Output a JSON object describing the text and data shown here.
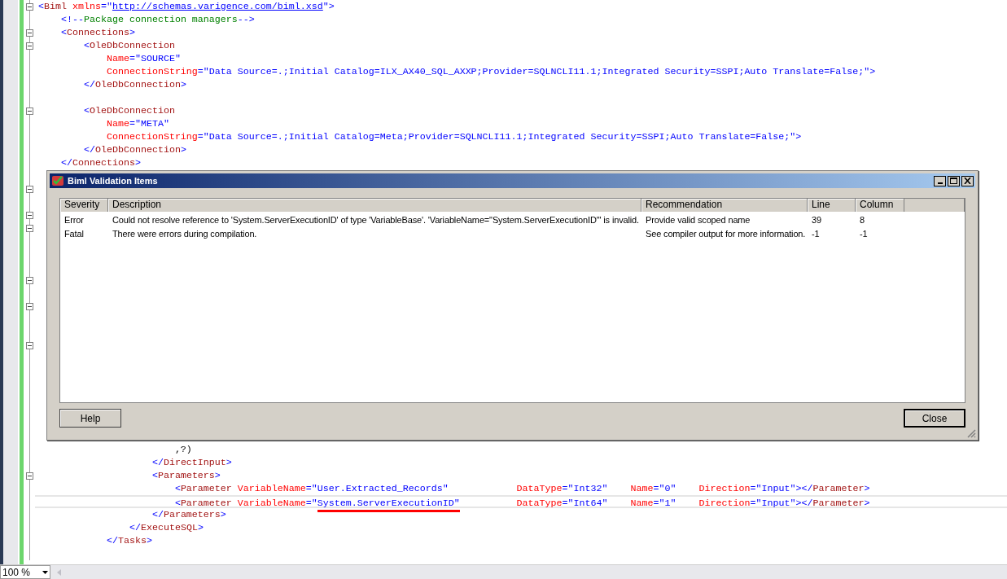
{
  "editor": {
    "lines": [
      {
        "foldable": true,
        "current": false,
        "tokens": [
          {
            "kind": "bracket",
            "text": "<"
          },
          {
            "kind": "tag",
            "text": "Biml"
          },
          {
            "kind": "attr",
            "text": " xmlns"
          },
          {
            "kind": "bracket",
            "text": "=\""
          },
          {
            "kind": "link",
            "text": "http://schemas.varigence.com/biml.xsd"
          },
          {
            "kind": "bracket",
            "text": "\">"
          }
        ]
      },
      {
        "foldable": false,
        "current": false,
        "tokens": [
          {
            "kind": "bracket",
            "text": "    <!--"
          },
          {
            "kind": "comment",
            "text": "Package connection managers"
          },
          {
            "kind": "bracket",
            "text": "-->"
          }
        ]
      },
      {
        "foldable": true,
        "current": false,
        "tokens": [
          {
            "kind": "bracket",
            "text": "    <"
          },
          {
            "kind": "tag",
            "text": "Connections"
          },
          {
            "kind": "bracket",
            "text": ">"
          }
        ]
      },
      {
        "foldable": true,
        "current": false,
        "tokens": [
          {
            "kind": "bracket",
            "text": "        <"
          },
          {
            "kind": "tag",
            "text": "OleDbConnection"
          }
        ]
      },
      {
        "foldable": false,
        "current": false,
        "tokens": [
          {
            "kind": "attr",
            "text": "            Name"
          },
          {
            "kind": "bracket",
            "text": "=\""
          },
          {
            "kind": "value",
            "text": "SOURCE"
          },
          {
            "kind": "bracket",
            "text": "\""
          }
        ]
      },
      {
        "foldable": false,
        "current": false,
        "tokens": [
          {
            "kind": "attr",
            "text": "            ConnectionString"
          },
          {
            "kind": "bracket",
            "text": "=\""
          },
          {
            "kind": "value",
            "text": "Data Source=.;Initial Catalog=ILX_AX40_SQL_AXXP;Provider=SQLNCLI11.1;Integrated Security=SSPI;Auto Translate=False;"
          },
          {
            "kind": "bracket",
            "text": "\">"
          }
        ]
      },
      {
        "foldable": false,
        "current": false,
        "tokens": [
          {
            "kind": "bracket",
            "text": "        </"
          },
          {
            "kind": "tag",
            "text": "OleDbConnection"
          },
          {
            "kind": "bracket",
            "text": ">"
          }
        ]
      },
      {
        "foldable": false,
        "current": false
      },
      {
        "foldable": true,
        "current": false,
        "tokens": [
          {
            "kind": "bracket",
            "text": "        <"
          },
          {
            "kind": "tag",
            "text": "OleDbConnection"
          }
        ]
      },
      {
        "foldable": false,
        "current": false,
        "tokens": [
          {
            "kind": "attr",
            "text": "            Name"
          },
          {
            "kind": "bracket",
            "text": "=\""
          },
          {
            "kind": "value",
            "text": "META"
          },
          {
            "kind": "bracket",
            "text": "\""
          }
        ]
      },
      {
        "foldable": false,
        "current": false,
        "tokens": [
          {
            "kind": "attr",
            "text": "            ConnectionString"
          },
          {
            "kind": "bracket",
            "text": "=\""
          },
          {
            "kind": "value",
            "text": "Data Source=.;Initial Catalog=Meta;Provider=SQLNCLI11.1;Integrated Security=SSPI;Auto Translate=False;"
          },
          {
            "kind": "bracket",
            "text": "\">"
          }
        ]
      },
      {
        "foldable": false,
        "current": false,
        "tokens": [
          {
            "kind": "bracket",
            "text": "        </"
          },
          {
            "kind": "tag",
            "text": "OleDbConnection"
          },
          {
            "kind": "bracket",
            "text": ">"
          }
        ]
      },
      {
        "foldable": false,
        "current": false,
        "tokens": [
          {
            "kind": "bracket",
            "text": "    </"
          },
          {
            "kind": "tag",
            "text": "Connections"
          },
          {
            "kind": "bracket",
            "text": ">"
          }
        ]
      },
      {
        "foldable": false,
        "current": false
      },
      {
        "foldable": true,
        "current": false
      },
      {
        "foldable": false,
        "current": false
      },
      {
        "foldable": true,
        "current": false
      },
      {
        "foldable": true,
        "current": false
      },
      {
        "foldable": false,
        "current": false
      },
      {
        "foldable": false,
        "current": false
      },
      {
        "foldable": false,
        "current": false
      },
      {
        "foldable": true,
        "current": false
      },
      {
        "foldable": false,
        "current": false
      },
      {
        "foldable": true,
        "current": false
      },
      {
        "foldable": false,
        "current": false
      },
      {
        "foldable": false,
        "current": false
      },
      {
        "foldable": true,
        "current": false
      },
      {
        "foldable": false,
        "current": false
      },
      {
        "foldable": false,
        "current": false
      },
      {
        "foldable": false,
        "current": false
      },
      {
        "foldable": false,
        "current": false
      },
      {
        "foldable": false,
        "current": false
      },
      {
        "foldable": false,
        "current": false
      },
      {
        "foldable": false,
        "current": false
      },
      {
        "foldable": false,
        "current": false,
        "tokens": [
          {
            "kind": "text",
            "text": "                        ,?)"
          }
        ]
      },
      {
        "foldable": false,
        "current": false,
        "tokens": [
          {
            "kind": "bracket",
            "text": "                    </"
          },
          {
            "kind": "tag",
            "text": "DirectInput"
          },
          {
            "kind": "bracket",
            "text": ">"
          }
        ]
      },
      {
        "foldable": true,
        "current": false,
        "tokens": [
          {
            "kind": "bracket",
            "text": "                    <"
          },
          {
            "kind": "tag",
            "text": "Parameters"
          },
          {
            "kind": "bracket",
            "text": ">"
          }
        ]
      },
      {
        "foldable": false,
        "current": false,
        "tokens": [
          {
            "kind": "bracket",
            "text": "                        <"
          },
          {
            "kind": "tag",
            "text": "Parameter"
          },
          {
            "kind": "attr",
            "text": " VariableName"
          },
          {
            "kind": "bracket",
            "text": "=\""
          },
          {
            "kind": "value",
            "text": "User.Extracted_Records"
          },
          {
            "kind": "bracket",
            "text": "\""
          },
          {
            "kind": "attr",
            "text": "            DataType"
          },
          {
            "kind": "bracket",
            "text": "=\""
          },
          {
            "kind": "value",
            "text": "Int32"
          },
          {
            "kind": "bracket",
            "text": "\""
          },
          {
            "kind": "attr",
            "text": "    Name"
          },
          {
            "kind": "bracket",
            "text": "=\""
          },
          {
            "kind": "value",
            "text": "0"
          },
          {
            "kind": "bracket",
            "text": "\""
          },
          {
            "kind": "attr",
            "text": "    Direction"
          },
          {
            "kind": "bracket",
            "text": "=\""
          },
          {
            "kind": "value",
            "text": "Input"
          },
          {
            "kind": "bracket",
            "text": "\"></"
          },
          {
            "kind": "tag",
            "text": "Parameter"
          },
          {
            "kind": "bracket",
            "text": ">"
          }
        ]
      },
      {
        "foldable": false,
        "current": true,
        "tokens": [
          {
            "kind": "bracket",
            "text": "                        <"
          },
          {
            "kind": "tag",
            "text": "Parameter"
          },
          {
            "kind": "attr",
            "text": " VariableName"
          },
          {
            "kind": "bracket",
            "text": "=\""
          },
          {
            "kind": "marked",
            "text": "System.ServerExecutionID\""
          },
          {
            "kind": "attr",
            "text": "          DataType"
          },
          {
            "kind": "bracket",
            "text": "=\""
          },
          {
            "kind": "value",
            "text": "Int64"
          },
          {
            "kind": "bracket",
            "text": "\""
          },
          {
            "kind": "attr",
            "text": "    Name"
          },
          {
            "kind": "bracket",
            "text": "=\""
          },
          {
            "kind": "value",
            "text": "1"
          },
          {
            "kind": "bracket",
            "text": "\""
          },
          {
            "kind": "attr",
            "text": "    Direction"
          },
          {
            "kind": "bracket",
            "text": "=\""
          },
          {
            "kind": "value",
            "text": "Input"
          },
          {
            "kind": "bracket",
            "text": "\"></"
          },
          {
            "kind": "tag",
            "text": "Parameter"
          },
          {
            "kind": "bracket",
            "text": ">"
          }
        ]
      },
      {
        "foldable": false,
        "current": false,
        "tokens": [
          {
            "kind": "bracket",
            "text": "                    </"
          },
          {
            "kind": "tag",
            "text": "Parameters"
          },
          {
            "kind": "bracket",
            "text": ">"
          }
        ]
      },
      {
        "foldable": false,
        "current": false,
        "tokens": [
          {
            "kind": "bracket",
            "text": "                </"
          },
          {
            "kind": "tag",
            "text": "ExecuteSQL"
          },
          {
            "kind": "bracket",
            "text": ">"
          }
        ]
      },
      {
        "foldable": false,
        "current": false,
        "tokens": [
          {
            "kind": "bracket",
            "text": "            </"
          },
          {
            "kind": "tag",
            "text": "Tasks"
          },
          {
            "kind": "bracket",
            "text": ">"
          }
        ]
      },
      {
        "foldable": false,
        "current": false
      }
    ]
  },
  "dialog": {
    "title": "Biml Validation Items",
    "columns": [
      "Severity",
      "Description",
      "Recommendation",
      "Line",
      "Column"
    ],
    "rows": [
      {
        "cells": [
          "Error",
          "Could not resolve reference to 'System.ServerExecutionID' of type 'VariableBase'. 'VariableName=\"System.ServerExecutionID\"' is invalid.",
          "Provide valid scoped name",
          "39",
          "8"
        ]
      },
      {
        "cells": [
          "Fatal",
          "There were errors during compilation.",
          "See compiler output for more information.",
          "-1",
          "-1"
        ]
      }
    ],
    "buttons": [
      "Help",
      "Close"
    ]
  },
  "zoom": {
    "value": "100 %"
  }
}
